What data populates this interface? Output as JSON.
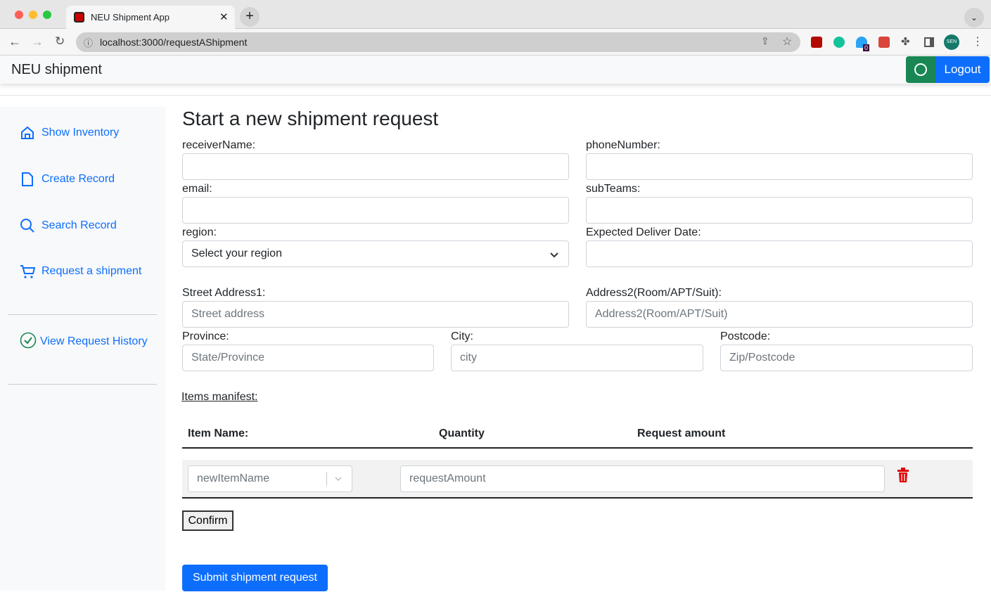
{
  "browser": {
    "tab_title": "NEU Shipment App",
    "url": "localhost:3000/requestAShipment",
    "profile": "SEN",
    "ext_badge": "0"
  },
  "navbar": {
    "brand": "NEU shipment",
    "logout": "Logout"
  },
  "sidebar": {
    "items": [
      {
        "label": "Show Inventory",
        "icon": "house-icon"
      },
      {
        "label": "Create Record",
        "icon": "file-icon"
      },
      {
        "label": "Search Record",
        "icon": "search-icon"
      },
      {
        "label": "Request a shipment",
        "icon": "cart-icon"
      },
      {
        "label": "View Request History",
        "icon": "check-circle-icon"
      }
    ]
  },
  "form": {
    "title": "Start a new shipment request",
    "receiverName": {
      "label": "receiverName:",
      "value": ""
    },
    "phoneNumber": {
      "label": "phoneNumber:",
      "value": ""
    },
    "email": {
      "label": "email:",
      "value": ""
    },
    "subTeams": {
      "label": "subTeams:",
      "value": ""
    },
    "region": {
      "label": "region:",
      "value": "Select your region"
    },
    "deliverDate": {
      "label": "Expected Deliver Date:",
      "value": ""
    },
    "street": {
      "label": "Street Address1:",
      "placeholder": "Street address"
    },
    "address2": {
      "label": "Address2(Room/APT/Suit):",
      "placeholder": "Address2(Room/APT/Suit)"
    },
    "province": {
      "label": "Province:",
      "placeholder": "State/Province"
    },
    "city": {
      "label": "City:",
      "placeholder": "city"
    },
    "postcode": {
      "label": "Postcode:",
      "placeholder": "Zip/Postcode"
    },
    "manifest_label": "Items manifest:",
    "table": {
      "headers": [
        "Item Name:",
        "Quantity",
        "Request amount"
      ],
      "rows": [
        {
          "item_placeholder": "newItemName",
          "amount_placeholder": "requestAmount"
        }
      ]
    },
    "confirm": "Confirm",
    "submit": "Submit shipment request"
  },
  "colors": {
    "primary": "#0d6efd",
    "success": "#198754",
    "danger": "#e00000"
  }
}
